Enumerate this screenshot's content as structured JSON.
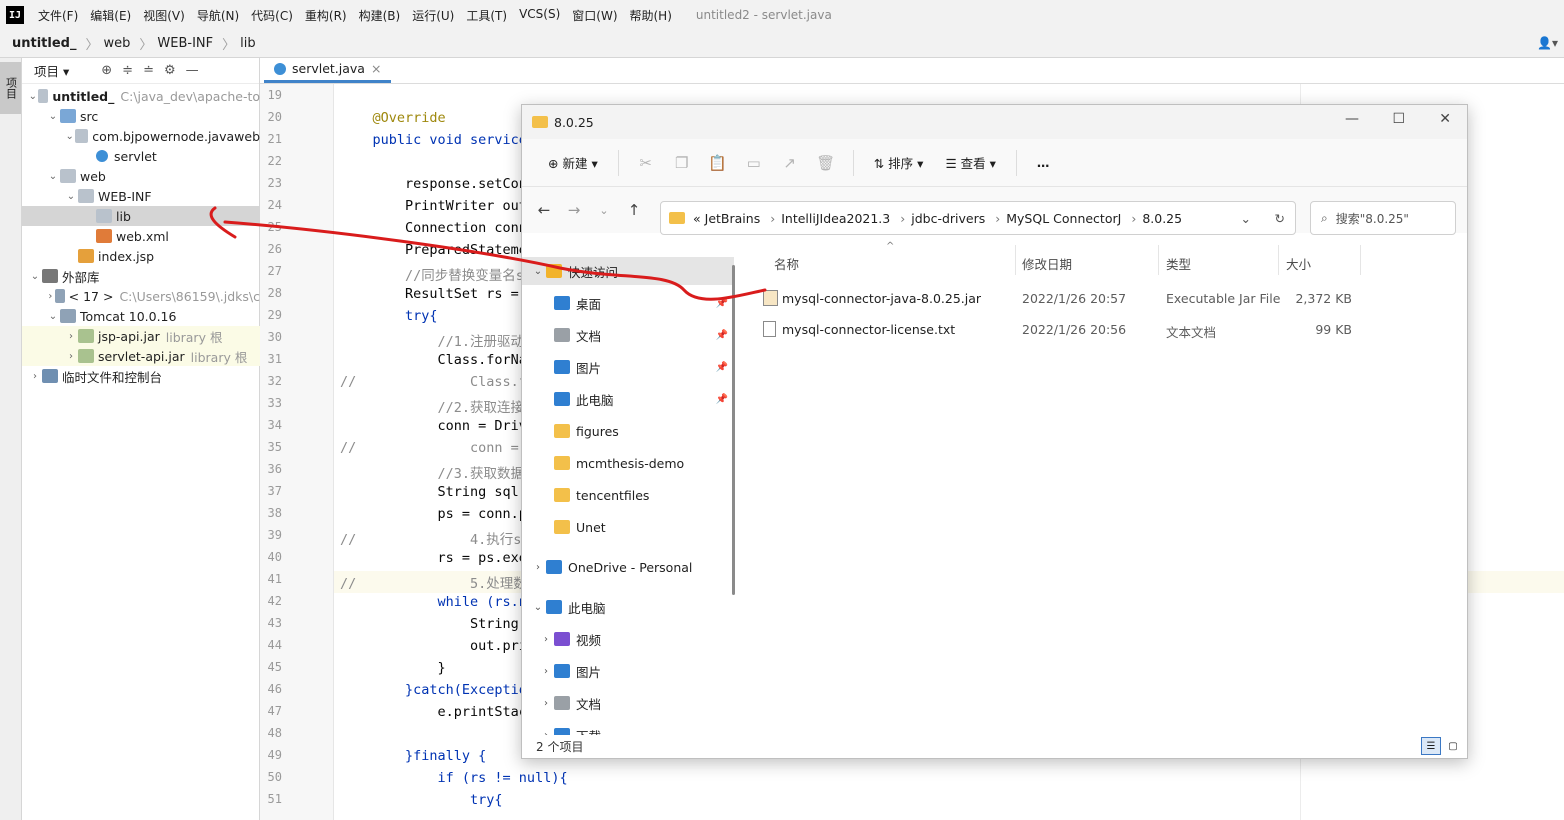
{
  "ide": {
    "logo": "IJ",
    "menus": [
      "文件(F)",
      "编辑(E)",
      "视图(V)",
      "导航(N)",
      "代码(C)",
      "重构(R)",
      "构建(B)",
      "运行(U)",
      "工具(T)",
      "VCS(S)",
      "窗口(W)",
      "帮助(H)"
    ],
    "window_title": "untitled2 - servlet.java",
    "breadcrumb": [
      "untitled_",
      "web",
      "WEB-INF",
      "lib"
    ],
    "strip_label": "项目",
    "project_label": "项目",
    "tab_label": "servlet.java"
  },
  "tree": [
    {
      "label": "untitled_",
      "hint": "C:\\java_dev\\apache-to",
      "icon": "folder",
      "arrow": "v",
      "indent": 0
    },
    {
      "label": "src",
      "hint": "",
      "icon": "src",
      "arrow": "v",
      "indent": 1
    },
    {
      "label": "com.bjpowernode.javaweb",
      "hint": "",
      "icon": "pkg",
      "arrow": "v",
      "indent": 2
    },
    {
      "label": "servlet",
      "hint": "",
      "icon": "cls",
      "arrow": "",
      "indent": 3
    },
    {
      "label": "web",
      "hint": "",
      "icon": "folder",
      "arrow": "v",
      "indent": 1
    },
    {
      "label": "WEB-INF",
      "hint": "",
      "icon": "folder",
      "arrow": "v",
      "indent": 2
    },
    {
      "label": "lib",
      "hint": "",
      "icon": "folder",
      "arrow": "",
      "indent": 3
    },
    {
      "label": "web.xml",
      "hint": "",
      "icon": "xml",
      "arrow": "",
      "indent": 3
    },
    {
      "label": "index.jsp",
      "hint": "",
      "icon": "jsp",
      "arrow": "",
      "indent": 2
    },
    {
      "label": "外部库",
      "hint": "",
      "icon": "libs",
      "arrow": "v",
      "indent": 0
    },
    {
      "label": "< 17 >",
      "hint": "C:\\Users\\86159\\.jdks\\c",
      "icon": "jdk",
      "arrow": ">",
      "indent": 1
    },
    {
      "label": "Tomcat 10.0.16",
      "hint": "",
      "icon": "jdk",
      "arrow": "v",
      "indent": 1
    },
    {
      "label": "jsp-api.jar",
      "hint": "library 根",
      "icon": "jar",
      "arrow": ">",
      "indent": 2
    },
    {
      "label": "servlet-api.jar",
      "hint": "library 根",
      "icon": "jar",
      "arrow": ">",
      "indent": 2
    },
    {
      "label": "临时文件和控制台",
      "hint": "",
      "icon": "scratch",
      "arrow": ">",
      "indent": 0
    }
  ],
  "code_lines": [
    {
      "n": "19",
      "t": ""
    },
    {
      "n": "20",
      "t": "    @Override"
    },
    {
      "n": "21",
      "t": "    public void service"
    },
    {
      "n": "22",
      "t": ""
    },
    {
      "n": "23",
      "t": "        response.setCon"
    },
    {
      "n": "24",
      "t": "        PrintWriter out"
    },
    {
      "n": "25",
      "t": "        Connection conn"
    },
    {
      "n": "26",
      "t": "        PreparedStateme"
    },
    {
      "n": "27",
      "t": "        //同步替换变量名sl"
    },
    {
      "n": "28",
      "t": "        ResultSet rs = "
    },
    {
      "n": "29",
      "t": "        try{"
    },
    {
      "n": "30",
      "t": "            //1.注册驱动"
    },
    {
      "n": "31",
      "t": "            Class.forNa"
    },
    {
      "n": "32",
      "t": "//              Class.for"
    },
    {
      "n": "33",
      "t": "            //2.获取连接"
    },
    {
      "n": "34",
      "t": "            conn = Driv"
    },
    {
      "n": "35",
      "t": "//              conn = Dr"
    },
    {
      "n": "36",
      "t": "            //3.获取数据"
    },
    {
      "n": "37",
      "t": "            String sql "
    },
    {
      "n": "38",
      "t": "            ps = conn.p"
    },
    {
      "n": "39",
      "t": "//              4.执行sql"
    },
    {
      "n": "40",
      "t": "            rs = ps.exe"
    },
    {
      "n": "41",
      "t": "//              5.处理数据"
    },
    {
      "n": "42",
      "t": "            while (rs.n"
    },
    {
      "n": "43",
      "t": "                String "
    },
    {
      "n": "44",
      "t": "                out.pri"
    },
    {
      "n": "45",
      "t": "            }"
    },
    {
      "n": "46",
      "t": "        }catch(Exceptio"
    },
    {
      "n": "47",
      "t": "            e.printStac"
    },
    {
      "n": "48",
      "t": ""
    },
    {
      "n": "49",
      "t": "        }finally {"
    },
    {
      "n": "50",
      "t": "            if (rs != null){"
    },
    {
      "n": "51",
      "t": "                try{"
    }
  ],
  "explorer": {
    "title": "8.0.25",
    "new_label": "新建",
    "sort_label": "排序",
    "view_label": "查看",
    "more_label": "…",
    "path": [
      "JetBrains",
      "IntelliJIdea2021.3",
      "jdbc-drivers",
      "MySQL ConnectorJ",
      "8.0.25"
    ],
    "path_prefix": "«",
    "search_placeholder": "搜索\"8.0.25\"",
    "nav": [
      {
        "label": "快速访问",
        "arrow": "v",
        "pin": false,
        "indent": 0,
        "color": "#f2b32b"
      },
      {
        "label": "桌面",
        "arrow": "",
        "pin": true,
        "indent": 1,
        "color": "#2f7fd1"
      },
      {
        "label": "文档",
        "arrow": "",
        "pin": true,
        "indent": 1,
        "color": "#9aa0a6"
      },
      {
        "label": "图片",
        "arrow": "",
        "pin": true,
        "indent": 1,
        "color": "#2f7fd1"
      },
      {
        "label": "此电脑",
        "arrow": "",
        "pin": true,
        "indent": 1,
        "color": "#2f7fd1"
      },
      {
        "label": "figures",
        "arrow": "",
        "pin": false,
        "indent": 1,
        "color": "#f3c04a"
      },
      {
        "label": "mcmthesis-demo",
        "arrow": "",
        "pin": false,
        "indent": 1,
        "color": "#f3c04a"
      },
      {
        "label": "tencentfiles",
        "arrow": "",
        "pin": false,
        "indent": 1,
        "color": "#f3c04a"
      },
      {
        "label": "Unet",
        "arrow": "",
        "pin": false,
        "indent": 1,
        "color": "#f3c04a"
      },
      {
        "label": "OneDrive - Personal",
        "arrow": ">",
        "pin": false,
        "indent": 0,
        "color": "#2f7fd1"
      },
      {
        "label": "此电脑",
        "arrow": "v",
        "pin": false,
        "indent": 0,
        "color": "#2f7fd1"
      },
      {
        "label": "视频",
        "arrow": ">",
        "pin": false,
        "indent": 1,
        "color": "#7b4fd1"
      },
      {
        "label": "图片",
        "arrow": ">",
        "pin": false,
        "indent": 1,
        "color": "#2f7fd1"
      },
      {
        "label": "文档",
        "arrow": ">",
        "pin": false,
        "indent": 1,
        "color": "#9aa0a6"
      },
      {
        "label": "下载",
        "arrow": ">",
        "pin": false,
        "indent": 1,
        "color": "#2f7fd1"
      }
    ],
    "columns": {
      "name": "名称",
      "date": "修改日期",
      "type": "类型",
      "size": "大小"
    },
    "files": [
      {
        "name": "mysql-connector-java-8.0.25.jar",
        "date": "2022/1/26 20:57",
        "type": "Executable Jar File",
        "size": "2,372 KB",
        "icon": "jar"
      },
      {
        "name": "mysql-connector-license.txt",
        "date": "2022/1/26 20:56",
        "type": "文本文档",
        "size": "99 KB",
        "icon": "txt"
      }
    ],
    "status": "2 个项目"
  }
}
